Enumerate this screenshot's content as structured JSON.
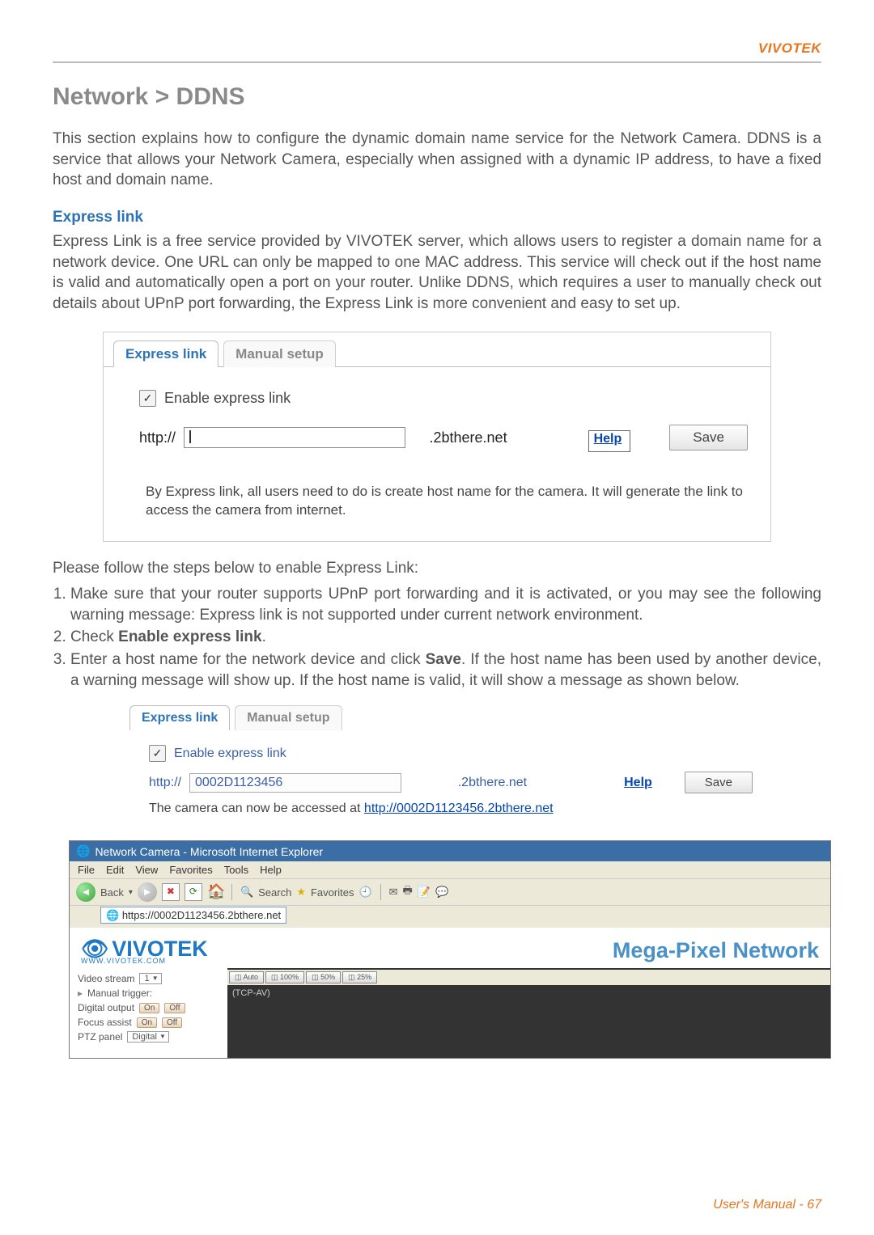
{
  "brand": "VIVOTEK",
  "page_title": "Network > DDNS",
  "intro": "This section explains how to configure the dynamic domain name service for the Network Camera. DDNS is a service that allows your Network Camera, especially when assigned with a dynamic IP address, to have a fixed host and domain name.",
  "express_heading": "Express link",
  "express_text": "Express Link is a free service provided by VIVOTEK server, which allows users to register a domain name for a network device. One URL can only be mapped to one MAC address. This service will check out if the host name is valid and automatically open a port on your router. Unlike DDNS, which requires a user to manually check out details about UPnP port forwarding, the Express Link is more convenient and easy to set up.",
  "tabs": {
    "express": "Express link",
    "manual": "Manual setup"
  },
  "panel1": {
    "enable_label": "Enable express link",
    "prefix": "http://",
    "suffix": ".2bthere.net",
    "help": "Help",
    "save": "Save",
    "info": "By Express link, all users need to do is create host name for the camera. It will generate the link to access the camera from internet."
  },
  "steps_intro": "Please follow the steps below to enable Express Link:",
  "steps": [
    "Make sure that your router supports UPnP port forwarding and it is activated, or you may see the following warning message: Express link is not supported under current network environment.",
    "Check Enable express link.",
    "Enter a host name for the network device and click Save. If the host name has been used by another device, a warning message will show up. If the host name is valid, it will show a message as shown below."
  ],
  "panel2": {
    "enable_label": "Enable express link",
    "prefix": "http://",
    "value": "0002D1123456",
    "suffix": ".2bthere.net",
    "help": "Help",
    "save": "Save",
    "msg_pre": "The camera can now be accessed at ",
    "url": "http://0002D1123456.2bthere.net"
  },
  "browser": {
    "title": "Network Camera - Microsoft Internet Explorer",
    "menu": [
      "File",
      "Edit",
      "View",
      "Favorites",
      "Tools",
      "Help"
    ],
    "back": "Back",
    "search": "Search",
    "fav": "Favorites",
    "address": "https://0002D1123456.2bthere.net",
    "logo_text": "VIVOTEK",
    "logo_sub": "WWW.VIVOTEK.COM",
    "cam_title": "Mega-Pixel Network",
    "side": {
      "stream_label": "Video stream",
      "stream_value": "1",
      "trigger": "Manual trigger:",
      "dout": "Digital output",
      "fa": "Focus assist",
      "ptz": "PTZ panel",
      "ptz_value": "Digital",
      "on": "On",
      "off": "Off"
    },
    "res": [
      "Auto",
      "100%",
      "50%",
      "25%"
    ],
    "stream_tag": "(TCP-AV)"
  },
  "step2_bold": "Enable express link",
  "step3_bold": "Save",
  "footer": "User's Manual - 67"
}
